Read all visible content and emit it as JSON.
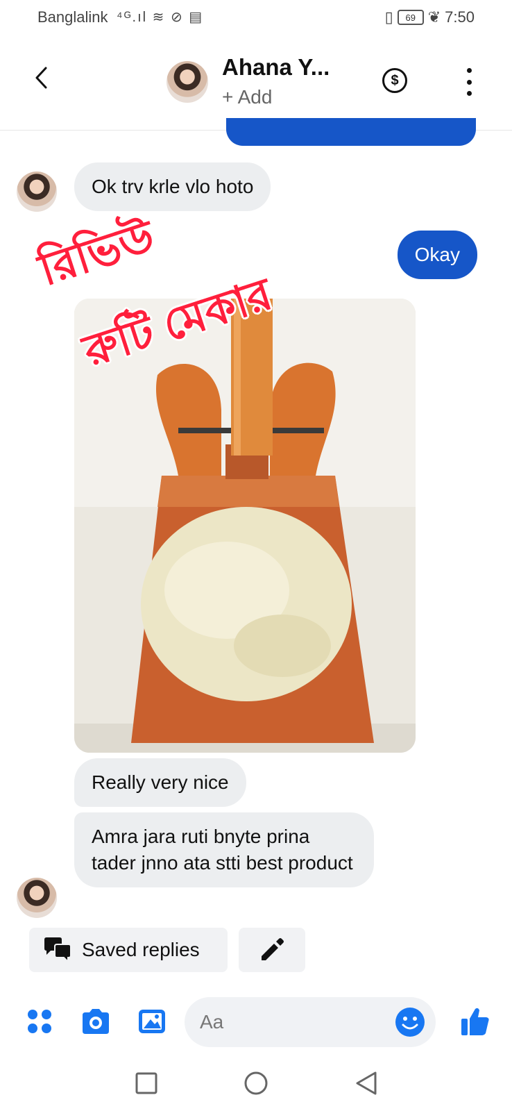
{
  "status_bar": {
    "carrier": "Banglalink",
    "network_icons": "⁴ᴳ.ıl ≋ ⊘ ▤",
    "battery": "69",
    "time": "7:50"
  },
  "header": {
    "contact_name": "Ahana Y...",
    "add_label": "+ Add",
    "dollar_symbol": "$"
  },
  "messages": [
    {
      "direction": "incoming",
      "text": "Ok trv krle vlo hoto"
    },
    {
      "direction": "outgoing",
      "text": "Okay"
    },
    {
      "direction": "incoming",
      "type": "photo"
    },
    {
      "direction": "incoming",
      "text": "Really very nice"
    },
    {
      "direction": "incoming",
      "text": "Amra jara ruti bnyte prina tader jnno ata stti best product"
    }
  ],
  "watermark": {
    "line1": "রিভিউ",
    "line2": "রুটি মেকার"
  },
  "quick_replies": {
    "saved_replies_label": "Saved replies"
  },
  "composer": {
    "placeholder": "Aa"
  },
  "colors": {
    "accent": "#1656c8",
    "icon_blue": "#1877f2",
    "incoming_bubble": "#eceef0",
    "watermark_red": "#ff1f3c"
  },
  "icons": {
    "back": "chevron-left-icon",
    "dollar": "dollar-circle-icon",
    "more": "more-vertical-icon",
    "saved_replies": "chat-bubbles-icon",
    "edit": "pencil-icon",
    "apps": "four-dots-icon",
    "camera": "camera-icon",
    "gallery": "image-icon",
    "emoji": "smiley-icon",
    "like": "thumbs-up-icon"
  }
}
